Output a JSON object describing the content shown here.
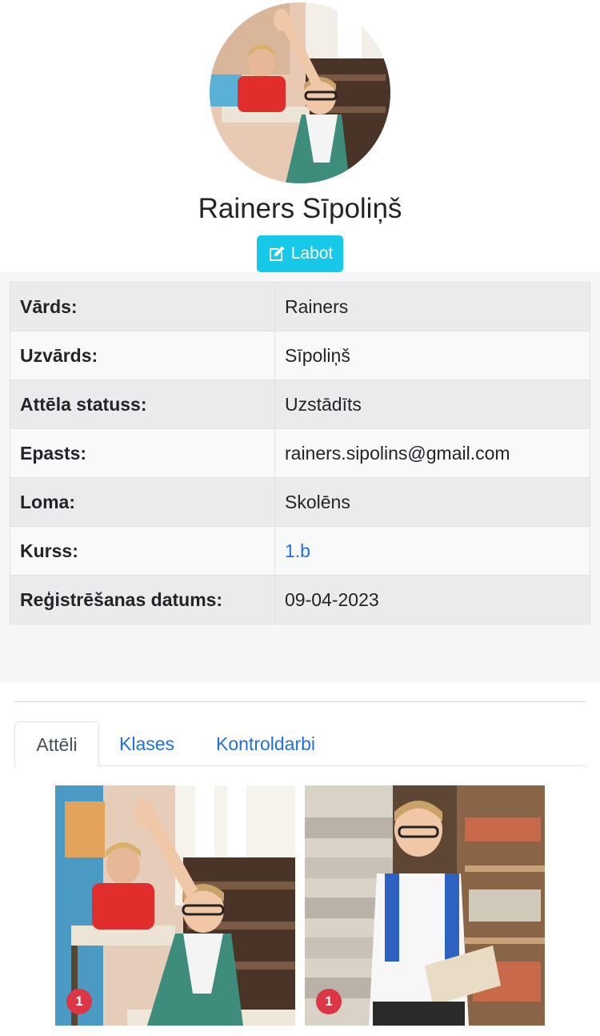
{
  "profile": {
    "name": "Rainers Sīpoliņš",
    "edit_label": "Labot",
    "avatar_icon": "classroom-boy-raising-hand-photo"
  },
  "details": [
    {
      "label": "Vārds:",
      "value": "Rainers"
    },
    {
      "label": "Uzvārds:",
      "value": "Sīpoliņš"
    },
    {
      "label": "Attēla statuss:",
      "value": "Uzstādīts"
    },
    {
      "label": "Epasts:",
      "value": "rainers.sipolins@gmail.com"
    },
    {
      "label": "Loma:",
      "value": "Skolēns"
    },
    {
      "label": "Kurss:",
      "value": "1.b"
    },
    {
      "label": "Reģistrēšanas datums:",
      "value": "09-04-2023"
    }
  ],
  "tabs": [
    {
      "label": "Attēli",
      "active": true
    },
    {
      "label": "Klases",
      "active": false
    },
    {
      "label": "Kontroldarbi",
      "active": false
    }
  ],
  "gallery": [
    {
      "icon": "classroom-boy-raising-hand-photo",
      "badge": "1"
    },
    {
      "icon": "library-boy-reading-book-photo",
      "badge": "1"
    }
  ],
  "colors": {
    "accent": "#17c9e8",
    "link": "#1e6fe8",
    "badge": "#dc3545"
  }
}
